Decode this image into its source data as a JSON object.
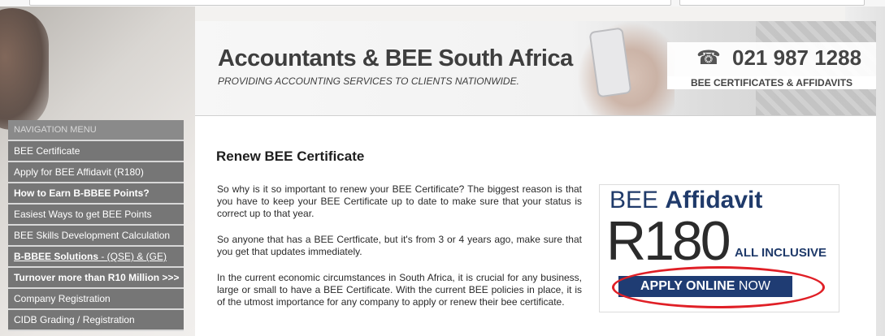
{
  "header": {
    "title_bold": "Accountants",
    "title_rest": " & BEE South Africa",
    "tagline": "PROVIDING ACCOUNTING SERVICES TO CLIENTS NATIONWIDE.",
    "phone_icon": "telephone-icon",
    "phone": "021 987 1288",
    "phone_sub": "BEE CERTIFICATES & AFFIDAVITS"
  },
  "nav": {
    "header": "NAVIGATION MENU",
    "items": [
      {
        "label": "BEE Certificate"
      },
      {
        "label": "Apply for BEE Affidavit (R180)"
      },
      {
        "label": "How to Earn B-BBEE Points?"
      },
      {
        "label": "Easiest Ways to get BEE Points"
      },
      {
        "label": "BEE Skills Development Calculation"
      },
      {
        "label_a": "B-BBEE Solutions",
        "label_b": " - (QSE) & (GE)"
      },
      {
        "label": "Turnover more than R10 Million >>>"
      },
      {
        "label": "Company Registration"
      },
      {
        "label": "CIDB Grading / Registration"
      }
    ]
  },
  "main": {
    "title": "Renew BEE Certificate",
    "paragraphs": [
      "So why is it so important to renew your BEE Certificate? The biggest reason is that you have to keep your BEE Certificate up to date to make sure that your status is correct up to that year.",
      "So anyone that has a BEE Certficate, but it's from 3 or 4 years ago, make sure that you get that updates immediately.",
      "In the current economic circumstances in South Africa, it is crucial for any business, large or small to have a BEE Certificate. With the current BEE policies in place, it is of the utmost importance for any company to apply or renew their bee certificate."
    ]
  },
  "ad": {
    "title_a": "BEE ",
    "title_b": "Affidavit",
    "price": "R180",
    "inclusive": "ALL INCLUSIVE",
    "button_a": "APPLY ONLINE",
    "button_b": " NOW",
    "accent": "#1f3c73",
    "circle_color": "#e01f26"
  }
}
